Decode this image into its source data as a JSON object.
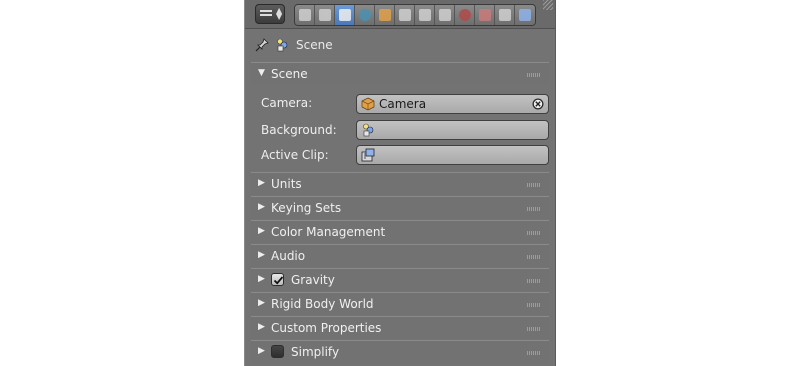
{
  "header": {
    "editor_type_icon": "properties-editor-icon",
    "context_tabs": [
      {
        "name": "render-icon",
        "active": false
      },
      {
        "name": "render-layers-icon",
        "active": false
      },
      {
        "name": "scene-icon",
        "active": true
      },
      {
        "name": "world-icon",
        "active": false
      },
      {
        "name": "object-icon",
        "active": false
      },
      {
        "name": "constraints-icon",
        "active": false
      },
      {
        "name": "modifiers-icon",
        "active": false
      },
      {
        "name": "data-icon",
        "active": false
      },
      {
        "name": "material-icon",
        "active": false
      },
      {
        "name": "texture-icon",
        "active": false
      },
      {
        "name": "particles-icon",
        "active": false
      },
      {
        "name": "physics-icon",
        "active": false
      }
    ]
  },
  "path": {
    "label": "Scene"
  },
  "scene_panel": {
    "title": "Scene",
    "camera": {
      "label": "Camera:",
      "value": "Camera"
    },
    "background": {
      "label": "Background:",
      "value": ""
    },
    "active_clip": {
      "label": "Active Clip:",
      "value": ""
    }
  },
  "panels": [
    {
      "title": "Units"
    },
    {
      "title": "Keying Sets"
    },
    {
      "title": "Color Management"
    },
    {
      "title": "Audio"
    },
    {
      "title": "Gravity",
      "checkbox": true,
      "checked": true
    },
    {
      "title": "Rigid Body World"
    },
    {
      "title": "Custom Properties"
    },
    {
      "title": "Simplify",
      "checkbox": true,
      "checked": false
    }
  ],
  "colors": {
    "panel_bg": "#737373",
    "active_tab": "#5680c2",
    "field_bg": "#b5b5b5"
  }
}
